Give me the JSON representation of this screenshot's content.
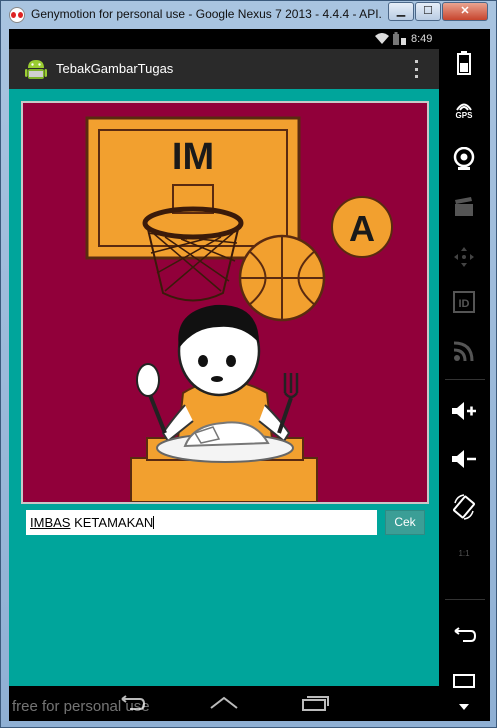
{
  "window": {
    "title": "Genymotion for personal use - Google Nexus 7 2013 - 4.4.4 - API...",
    "minimize_label": "▁",
    "maximize_label": "☐",
    "close_label": "✕"
  },
  "statusbar": {
    "time": "8:49"
  },
  "app": {
    "title": "TebakGambarTugas"
  },
  "puzzle": {
    "board_text": "IM",
    "circle_letter": "A"
  },
  "answer": {
    "value_underlined": "IMBAS",
    "value_rest": " KETAMAKAN",
    "submit_label": "Cek"
  },
  "sidebar": {
    "gps_label": "GPS",
    "id_label": "ID",
    "ratio_label": "1:1"
  },
  "watermark": "free for personal use",
  "colors": {
    "content_bg": "#00a59b",
    "picture_bg": "#91003a",
    "orange": "#f2a02f"
  }
}
